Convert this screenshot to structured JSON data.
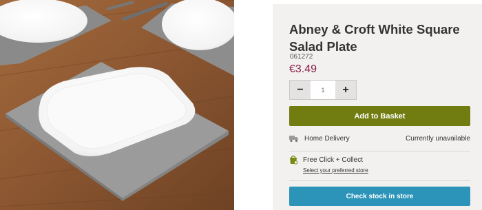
{
  "product": {
    "title": "Abney & Croft White Square Salad Plate",
    "sku": "061272",
    "price": "€3.49",
    "image_alt": "white square salad plate on grey placemat"
  },
  "quantity": {
    "value": "1",
    "decrement_label": "−",
    "increment_label": "+"
  },
  "actions": {
    "add_to_basket": "Add to Basket",
    "check_stock": "Check stock in store"
  },
  "delivery": {
    "label": "Home Delivery",
    "status": "Currently unavailable",
    "icon": "truck-icon"
  },
  "collect": {
    "label": "Free Click + Collect",
    "link": "Select your preferred store",
    "icon": "shopping-bag-icon"
  },
  "colors": {
    "price": "#8a1d4c",
    "add_button": "#717d11",
    "stock_button": "#2b94b8",
    "panel_bg": "#f2f1ef"
  }
}
